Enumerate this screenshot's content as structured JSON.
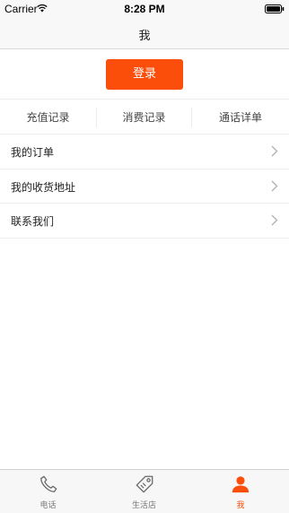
{
  "status_bar": {
    "carrier": "Carrier",
    "time": "8:28 PM",
    "wifi_icon": "wifi-icon",
    "battery_icon": "battery-icon"
  },
  "nav": {
    "title": "我"
  },
  "login": {
    "label": "登录",
    "color": "#fb4e0b"
  },
  "records": [
    {
      "label": "充值记录"
    },
    {
      "label": "消费记录"
    },
    {
      "label": "通话详单"
    }
  ],
  "menu": [
    {
      "label": "我的订单",
      "icon": "chevron-right-icon"
    },
    {
      "label": "我的收货地址",
      "icon": "chevron-right-icon"
    },
    {
      "label": "联系我们",
      "icon": "chevron-right-icon"
    }
  ],
  "tabs": [
    {
      "label": "电话",
      "icon": "phone-icon",
      "active": false
    },
    {
      "label": "生活店",
      "icon": "tag-icon",
      "active": false
    },
    {
      "label": "我",
      "icon": "person-icon",
      "active": true
    }
  ],
  "colors": {
    "accent": "#fb4e0b",
    "tab_inactive": "#777777"
  }
}
